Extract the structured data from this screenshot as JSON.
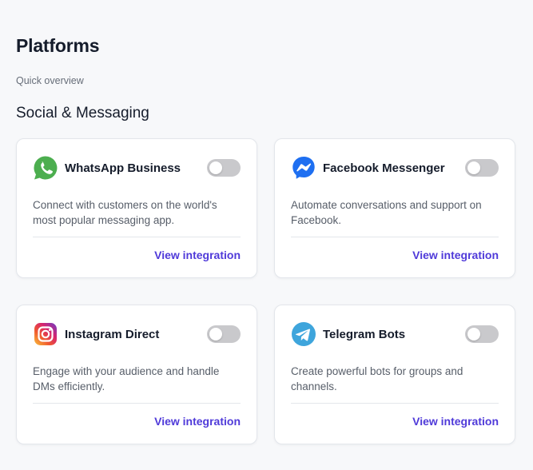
{
  "header": {
    "title": "Platforms",
    "subtitle": "Quick overview"
  },
  "section": {
    "title": "Social & Messaging"
  },
  "cards": [
    {
      "name": "WhatsApp Business",
      "icon": "whatsapp-icon",
      "description": "Connect with customers on the world's most popular messaging app.",
      "enabled": false,
      "link_label": "View integration"
    },
    {
      "name": "Facebook Messenger",
      "icon": "messenger-icon",
      "description": "Automate conversations and support on Facebook.",
      "enabled": false,
      "link_label": "View integration"
    },
    {
      "name": "Instagram Direct",
      "icon": "instagram-icon",
      "description": "Engage with your audience and handle DMs efficiently.",
      "enabled": false,
      "link_label": "View integration"
    },
    {
      "name": "Telegram Bots",
      "icon": "telegram-icon",
      "description": "Create powerful bots for groups and channels.",
      "enabled": false,
      "link_label": "View integration"
    }
  ],
  "colors": {
    "accent": "#4f3ad9",
    "toggle_off": "#c9c9cc",
    "whatsapp": "#4cae4f",
    "messenger": "#1e6ff1",
    "telegram": "#3ea5dc"
  }
}
